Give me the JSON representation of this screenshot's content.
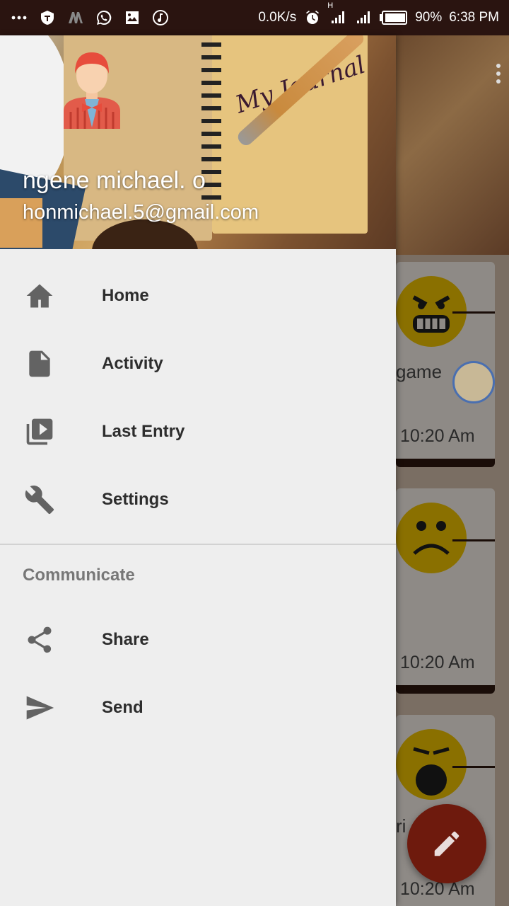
{
  "statusbar": {
    "network_speed": "0.0K/s",
    "network_type": "H",
    "battery": "90%",
    "time": "6:38 PM",
    "icons": [
      "more-icon",
      "shield-app-icon",
      "m-app-icon",
      "whatsapp-icon",
      "gallery-icon",
      "music-icon",
      "alarm-icon",
      "signal-icon",
      "battery-icon"
    ]
  },
  "drawer": {
    "header": {
      "background_text": "My Journal",
      "user_name": "ngene michael. o",
      "user_email": "honmichael.5@gmail.com"
    },
    "items": [
      {
        "label": "Home",
        "icon": "home-icon"
      },
      {
        "label": "Activity",
        "icon": "description-icon"
      },
      {
        "label": "Last Entry",
        "icon": "video-library-icon"
      },
      {
        "label": "Settings",
        "icon": "wrench-icon"
      }
    ],
    "section": {
      "title": "Communicate",
      "items": [
        {
          "label": "Share",
          "icon": "share-icon"
        },
        {
          "label": "Send",
          "icon": "send-icon"
        }
      ]
    }
  },
  "background": {
    "cards": [
      {
        "mood": "angry",
        "text": "game",
        "time": "10:20 Am"
      },
      {
        "mood": "sad",
        "text": "",
        "time": "10:20 Am"
      },
      {
        "mood": "shocked",
        "text": "ri",
        "time": "10:20 Am"
      }
    ],
    "fab_icon": "edit-icon"
  },
  "colors": {
    "statusbar": "#2a1410",
    "drawer_bg": "#eeeeee",
    "fab": "#6e1a0d",
    "emoji": "#8a7000"
  }
}
